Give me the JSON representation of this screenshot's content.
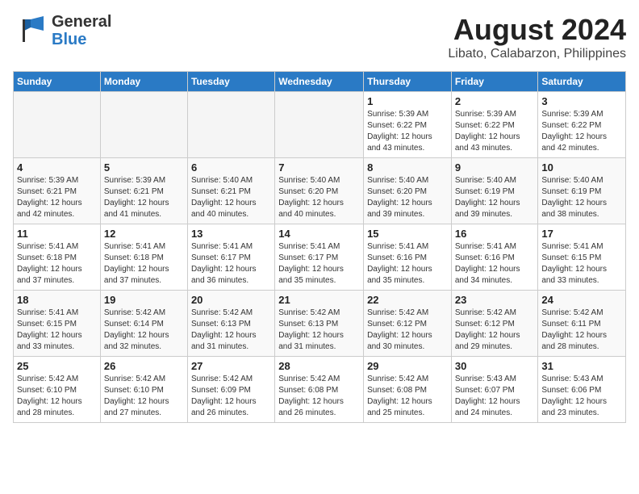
{
  "logo": {
    "line1": "General",
    "line2": "Blue"
  },
  "title": "August 2024",
  "location": "Libato, Calabarzon, Philippines",
  "days_of_week": [
    "Sunday",
    "Monday",
    "Tuesday",
    "Wednesday",
    "Thursday",
    "Friday",
    "Saturday"
  ],
  "weeks": [
    [
      {
        "day": "",
        "info": ""
      },
      {
        "day": "",
        "info": ""
      },
      {
        "day": "",
        "info": ""
      },
      {
        "day": "",
        "info": ""
      },
      {
        "day": "1",
        "info": "Sunrise: 5:39 AM\nSunset: 6:22 PM\nDaylight: 12 hours\nand 43 minutes."
      },
      {
        "day": "2",
        "info": "Sunrise: 5:39 AM\nSunset: 6:22 PM\nDaylight: 12 hours\nand 43 minutes."
      },
      {
        "day": "3",
        "info": "Sunrise: 5:39 AM\nSunset: 6:22 PM\nDaylight: 12 hours\nand 42 minutes."
      }
    ],
    [
      {
        "day": "4",
        "info": "Sunrise: 5:39 AM\nSunset: 6:21 PM\nDaylight: 12 hours\nand 42 minutes."
      },
      {
        "day": "5",
        "info": "Sunrise: 5:39 AM\nSunset: 6:21 PM\nDaylight: 12 hours\nand 41 minutes."
      },
      {
        "day": "6",
        "info": "Sunrise: 5:40 AM\nSunset: 6:21 PM\nDaylight: 12 hours\nand 40 minutes."
      },
      {
        "day": "7",
        "info": "Sunrise: 5:40 AM\nSunset: 6:20 PM\nDaylight: 12 hours\nand 40 minutes."
      },
      {
        "day": "8",
        "info": "Sunrise: 5:40 AM\nSunset: 6:20 PM\nDaylight: 12 hours\nand 39 minutes."
      },
      {
        "day": "9",
        "info": "Sunrise: 5:40 AM\nSunset: 6:19 PM\nDaylight: 12 hours\nand 39 minutes."
      },
      {
        "day": "10",
        "info": "Sunrise: 5:40 AM\nSunset: 6:19 PM\nDaylight: 12 hours\nand 38 minutes."
      }
    ],
    [
      {
        "day": "11",
        "info": "Sunrise: 5:41 AM\nSunset: 6:18 PM\nDaylight: 12 hours\nand 37 minutes."
      },
      {
        "day": "12",
        "info": "Sunrise: 5:41 AM\nSunset: 6:18 PM\nDaylight: 12 hours\nand 37 minutes."
      },
      {
        "day": "13",
        "info": "Sunrise: 5:41 AM\nSunset: 6:17 PM\nDaylight: 12 hours\nand 36 minutes."
      },
      {
        "day": "14",
        "info": "Sunrise: 5:41 AM\nSunset: 6:17 PM\nDaylight: 12 hours\nand 35 minutes."
      },
      {
        "day": "15",
        "info": "Sunrise: 5:41 AM\nSunset: 6:16 PM\nDaylight: 12 hours\nand 35 minutes."
      },
      {
        "day": "16",
        "info": "Sunrise: 5:41 AM\nSunset: 6:16 PM\nDaylight: 12 hours\nand 34 minutes."
      },
      {
        "day": "17",
        "info": "Sunrise: 5:41 AM\nSunset: 6:15 PM\nDaylight: 12 hours\nand 33 minutes."
      }
    ],
    [
      {
        "day": "18",
        "info": "Sunrise: 5:41 AM\nSunset: 6:15 PM\nDaylight: 12 hours\nand 33 minutes."
      },
      {
        "day": "19",
        "info": "Sunrise: 5:42 AM\nSunset: 6:14 PM\nDaylight: 12 hours\nand 32 minutes."
      },
      {
        "day": "20",
        "info": "Sunrise: 5:42 AM\nSunset: 6:13 PM\nDaylight: 12 hours\nand 31 minutes."
      },
      {
        "day": "21",
        "info": "Sunrise: 5:42 AM\nSunset: 6:13 PM\nDaylight: 12 hours\nand 31 minutes."
      },
      {
        "day": "22",
        "info": "Sunrise: 5:42 AM\nSunset: 6:12 PM\nDaylight: 12 hours\nand 30 minutes."
      },
      {
        "day": "23",
        "info": "Sunrise: 5:42 AM\nSunset: 6:12 PM\nDaylight: 12 hours\nand 29 minutes."
      },
      {
        "day": "24",
        "info": "Sunrise: 5:42 AM\nSunset: 6:11 PM\nDaylight: 12 hours\nand 28 minutes."
      }
    ],
    [
      {
        "day": "25",
        "info": "Sunrise: 5:42 AM\nSunset: 6:10 PM\nDaylight: 12 hours\nand 28 minutes."
      },
      {
        "day": "26",
        "info": "Sunrise: 5:42 AM\nSunset: 6:10 PM\nDaylight: 12 hours\nand 27 minutes."
      },
      {
        "day": "27",
        "info": "Sunrise: 5:42 AM\nSunset: 6:09 PM\nDaylight: 12 hours\nand 26 minutes."
      },
      {
        "day": "28",
        "info": "Sunrise: 5:42 AM\nSunset: 6:08 PM\nDaylight: 12 hours\nand 26 minutes."
      },
      {
        "day": "29",
        "info": "Sunrise: 5:42 AM\nSunset: 6:08 PM\nDaylight: 12 hours\nand 25 minutes."
      },
      {
        "day": "30",
        "info": "Sunrise: 5:43 AM\nSunset: 6:07 PM\nDaylight: 12 hours\nand 24 minutes."
      },
      {
        "day": "31",
        "info": "Sunrise: 5:43 AM\nSunset: 6:06 PM\nDaylight: 12 hours\nand 23 minutes."
      }
    ]
  ]
}
